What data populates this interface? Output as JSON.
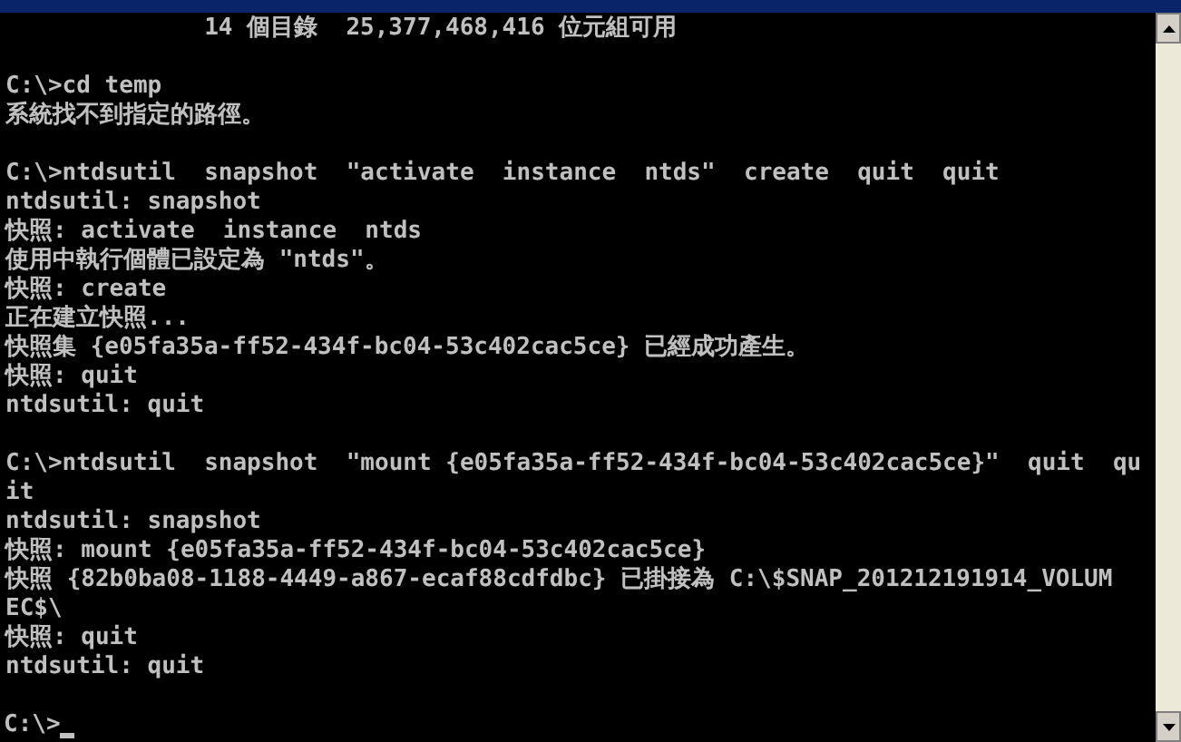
{
  "console": {
    "blocks": [
      [
        "              14 個目錄  25,377,468,416 位元組可用"
      ],
      [
        "C:\\>cd temp",
        "系統找不到指定的路徑。"
      ],
      [
        "C:\\>ntdsutil  snapshot  \"activate  instance  ntds\"  create  quit  quit",
        "ntdsutil: snapshot",
        "快照: activate  instance  ntds",
        "使用中執行個體已設定為 \"ntds\"。",
        "快照: create",
        "正在建立快照...",
        "快照集 {e05fa35a-ff52-434f-bc04-53c402cac5ce} 已經成功產生。",
        "快照: quit",
        "ntdsutil: quit"
      ],
      [
        "C:\\>ntdsutil  snapshot  \"mount {e05fa35a-ff52-434f-bc04-53c402cac5ce}\"  quit  qu",
        "it",
        "ntdsutil: snapshot",
        "快照: mount {e05fa35a-ff52-434f-bc04-53c402cac5ce}",
        "快照 {82b0ba08-1188-4449-a867-ecaf88cdfdbc} 已掛接為 C:\\$SNAP_201212191914_VOLUM",
        "EC$\\",
        "快照: quit",
        "ntdsutil: quit"
      ]
    ],
    "prompt": {
      "text": "C:\\>",
      "cursor": true
    }
  }
}
